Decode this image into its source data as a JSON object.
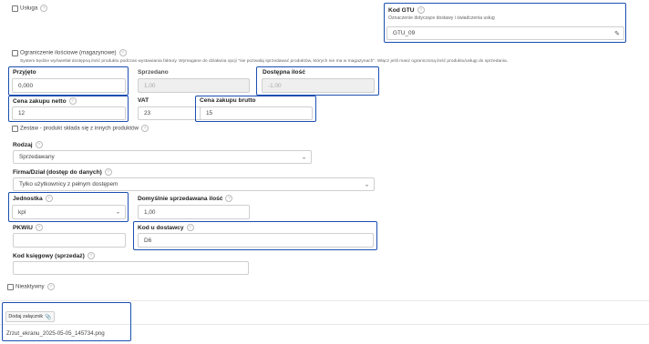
{
  "usluga": {
    "label": "Usługa"
  },
  "gtu": {
    "label": "Kod GTU",
    "description": "Oznaczenie dotyczące dostawy i świadczenia usług",
    "value": "GTU_09"
  },
  "limit": {
    "label": "Ograniczenie ilościowe (magazynowe)",
    "description": "System będzie wyświetlał dostępną ilość produktu podczas wystawiania faktury. Wymagane do działania opcji \"nie pozwalaj sprzedawać produktów, których nie ma w magazynach\". Włącz jeśli masz ograniczoną ilość produktu/usługi do sprzedania."
  },
  "stock": {
    "przyjeto": {
      "label": "Przyjęto",
      "value": "0,000"
    },
    "sprzedano": {
      "label": "Sprzedano",
      "value": "1,00"
    },
    "dostepna": {
      "label": "Dostępna ilość",
      "value": "-1,00"
    }
  },
  "price": {
    "netto": {
      "label": "Cena zakupu netto",
      "value": "12"
    },
    "vat": {
      "label": "VAT",
      "value": "23"
    },
    "brutto": {
      "label": "Cena zakupu brutto",
      "value": "15"
    }
  },
  "zestaw": {
    "label": "Zestaw - produkt składa się z innych produktów"
  },
  "rodzaj": {
    "label": "Rodzaj",
    "value": "Sprzedawany"
  },
  "firma": {
    "label": "Firma/Dział (dostęp do danych)",
    "value": "Tylko użytkownicy z pełnym dostępem"
  },
  "jednostka": {
    "label": "Jednostka",
    "value": "kpl"
  },
  "domyslna": {
    "label": "Domyślnie sprzedawana ilość",
    "value": "1,00"
  },
  "pkwiu": {
    "label": "PKWiU",
    "value": ""
  },
  "kod_dostawcy": {
    "label": "Kod u dostawcy",
    "value": "D6"
  },
  "kod_ksiegowy": {
    "label": "Kod księgowy (sprzedaż)",
    "value": ""
  },
  "nieaktywny": {
    "label": "Nieaktywny"
  },
  "attachments": {
    "button_label": "Dodaj załącznik",
    "file_name": "Zrzut_ekranu_2025-05-05_145734.png"
  },
  "icons": {
    "help": "question-circle-icon",
    "pencil": "pencil-icon",
    "paperclip": "paperclip-icon",
    "chevron": "chevron-down-icon"
  }
}
